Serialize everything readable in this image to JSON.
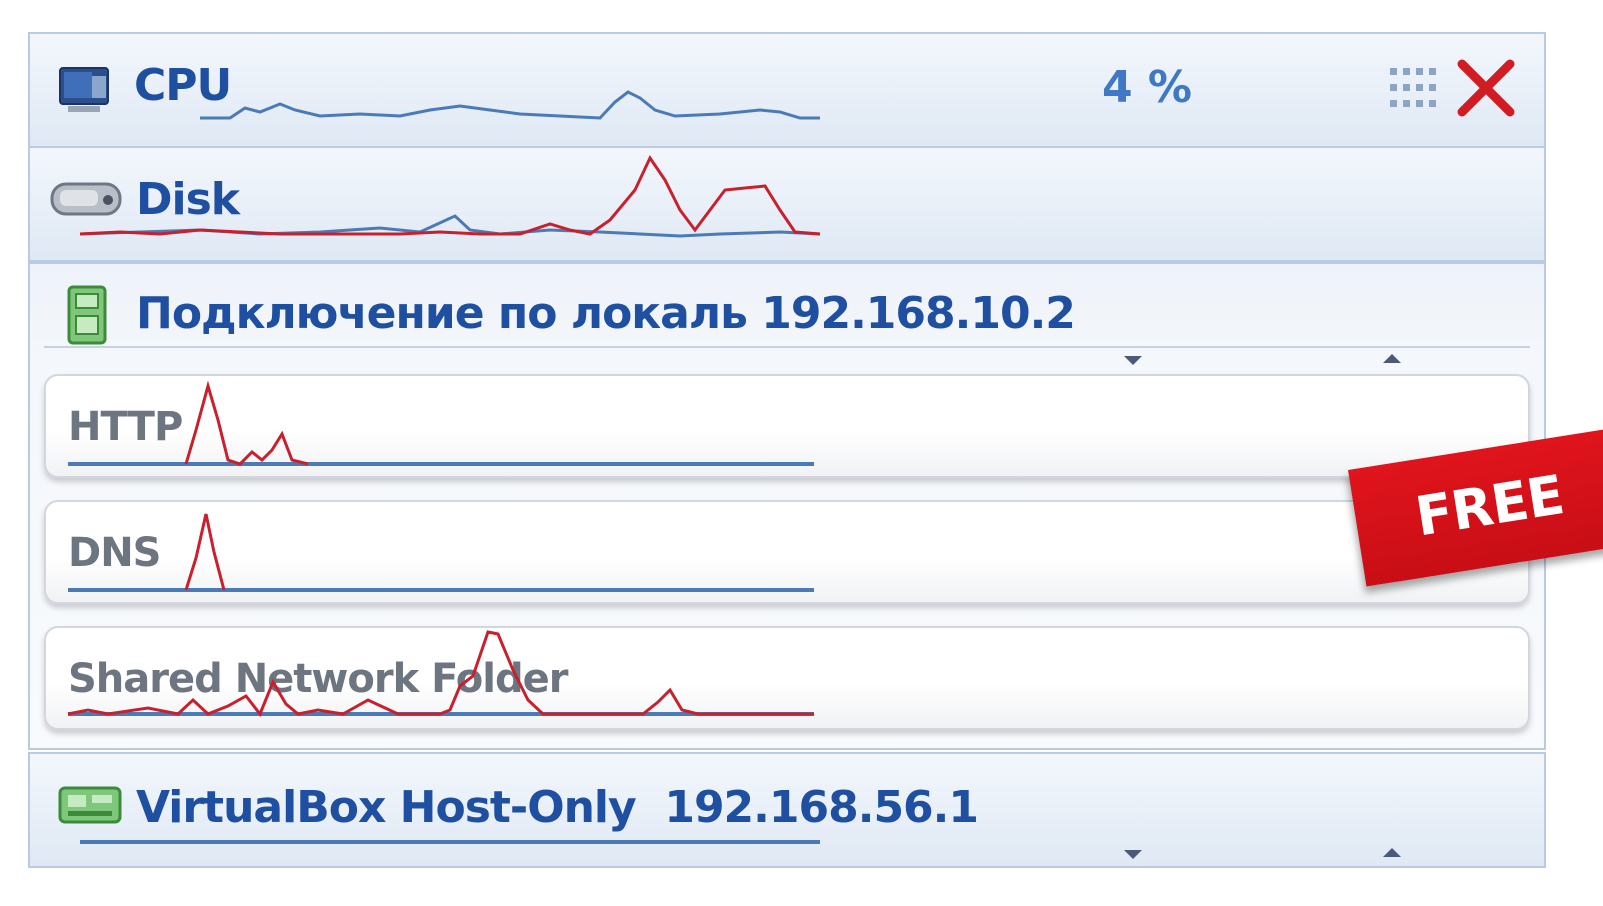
{
  "cpu": {
    "label": "CPU",
    "value": "4 %"
  },
  "disk": {
    "label": "Disk"
  },
  "connection": {
    "label": "Подключение по локаль 192.168.10.2"
  },
  "protocols": [
    {
      "label": "HTTP"
    },
    {
      "label": "DNS"
    },
    {
      "label": "Shared Network Folder"
    }
  ],
  "virtualbox": {
    "label": "VirtualBox Host-Only  192.168.56.1"
  },
  "badge": {
    "label": "FREE"
  },
  "colors": {
    "title": "#1f4fa0",
    "value": "#3f78c4",
    "graph_blue": "#4a7bb7",
    "graph_red": "#c8202c",
    "close_red": "#d01c22",
    "badge_red": "#d3121a"
  },
  "icons": [
    "monitor-icon",
    "disk-drive-icon",
    "network-adapter-icon",
    "virtual-network-icon",
    "grip-icon",
    "close-icon"
  ]
}
